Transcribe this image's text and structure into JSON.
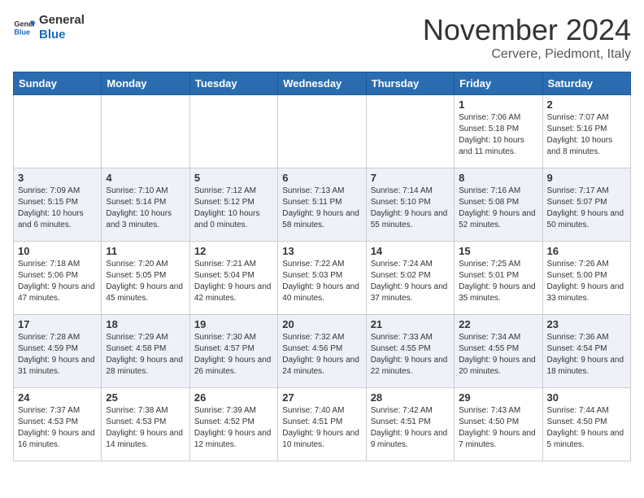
{
  "header": {
    "logo_line1": "General",
    "logo_line2": "Blue",
    "month": "November 2024",
    "location": "Cervere, Piedmont, Italy"
  },
  "weekdays": [
    "Sunday",
    "Monday",
    "Tuesday",
    "Wednesday",
    "Thursday",
    "Friday",
    "Saturday"
  ],
  "weeks": [
    [
      {
        "day": "",
        "info": ""
      },
      {
        "day": "",
        "info": ""
      },
      {
        "day": "",
        "info": ""
      },
      {
        "day": "",
        "info": ""
      },
      {
        "day": "",
        "info": ""
      },
      {
        "day": "1",
        "info": "Sunrise: 7:06 AM\nSunset: 5:18 PM\nDaylight: 10 hours and 11 minutes."
      },
      {
        "day": "2",
        "info": "Sunrise: 7:07 AM\nSunset: 5:16 PM\nDaylight: 10 hours and 8 minutes."
      }
    ],
    [
      {
        "day": "3",
        "info": "Sunrise: 7:09 AM\nSunset: 5:15 PM\nDaylight: 10 hours and 6 minutes."
      },
      {
        "day": "4",
        "info": "Sunrise: 7:10 AM\nSunset: 5:14 PM\nDaylight: 10 hours and 3 minutes."
      },
      {
        "day": "5",
        "info": "Sunrise: 7:12 AM\nSunset: 5:12 PM\nDaylight: 10 hours and 0 minutes."
      },
      {
        "day": "6",
        "info": "Sunrise: 7:13 AM\nSunset: 5:11 PM\nDaylight: 9 hours and 58 minutes."
      },
      {
        "day": "7",
        "info": "Sunrise: 7:14 AM\nSunset: 5:10 PM\nDaylight: 9 hours and 55 minutes."
      },
      {
        "day": "8",
        "info": "Sunrise: 7:16 AM\nSunset: 5:08 PM\nDaylight: 9 hours and 52 minutes."
      },
      {
        "day": "9",
        "info": "Sunrise: 7:17 AM\nSunset: 5:07 PM\nDaylight: 9 hours and 50 minutes."
      }
    ],
    [
      {
        "day": "10",
        "info": "Sunrise: 7:18 AM\nSunset: 5:06 PM\nDaylight: 9 hours and 47 minutes."
      },
      {
        "day": "11",
        "info": "Sunrise: 7:20 AM\nSunset: 5:05 PM\nDaylight: 9 hours and 45 minutes."
      },
      {
        "day": "12",
        "info": "Sunrise: 7:21 AM\nSunset: 5:04 PM\nDaylight: 9 hours and 42 minutes."
      },
      {
        "day": "13",
        "info": "Sunrise: 7:22 AM\nSunset: 5:03 PM\nDaylight: 9 hours and 40 minutes."
      },
      {
        "day": "14",
        "info": "Sunrise: 7:24 AM\nSunset: 5:02 PM\nDaylight: 9 hours and 37 minutes."
      },
      {
        "day": "15",
        "info": "Sunrise: 7:25 AM\nSunset: 5:01 PM\nDaylight: 9 hours and 35 minutes."
      },
      {
        "day": "16",
        "info": "Sunrise: 7:26 AM\nSunset: 5:00 PM\nDaylight: 9 hours and 33 minutes."
      }
    ],
    [
      {
        "day": "17",
        "info": "Sunrise: 7:28 AM\nSunset: 4:59 PM\nDaylight: 9 hours and 31 minutes."
      },
      {
        "day": "18",
        "info": "Sunrise: 7:29 AM\nSunset: 4:58 PM\nDaylight: 9 hours and 28 minutes."
      },
      {
        "day": "19",
        "info": "Sunrise: 7:30 AM\nSunset: 4:57 PM\nDaylight: 9 hours and 26 minutes."
      },
      {
        "day": "20",
        "info": "Sunrise: 7:32 AM\nSunset: 4:56 PM\nDaylight: 9 hours and 24 minutes."
      },
      {
        "day": "21",
        "info": "Sunrise: 7:33 AM\nSunset: 4:55 PM\nDaylight: 9 hours and 22 minutes."
      },
      {
        "day": "22",
        "info": "Sunrise: 7:34 AM\nSunset: 4:55 PM\nDaylight: 9 hours and 20 minutes."
      },
      {
        "day": "23",
        "info": "Sunrise: 7:36 AM\nSunset: 4:54 PM\nDaylight: 9 hours and 18 minutes."
      }
    ],
    [
      {
        "day": "24",
        "info": "Sunrise: 7:37 AM\nSunset: 4:53 PM\nDaylight: 9 hours and 16 minutes."
      },
      {
        "day": "25",
        "info": "Sunrise: 7:38 AM\nSunset: 4:53 PM\nDaylight: 9 hours and 14 minutes."
      },
      {
        "day": "26",
        "info": "Sunrise: 7:39 AM\nSunset: 4:52 PM\nDaylight: 9 hours and 12 minutes."
      },
      {
        "day": "27",
        "info": "Sunrise: 7:40 AM\nSunset: 4:51 PM\nDaylight: 9 hours and 10 minutes."
      },
      {
        "day": "28",
        "info": "Sunrise: 7:42 AM\nSunset: 4:51 PM\nDaylight: 9 hours and 9 minutes."
      },
      {
        "day": "29",
        "info": "Sunrise: 7:43 AM\nSunset: 4:50 PM\nDaylight: 9 hours and 7 minutes."
      },
      {
        "day": "30",
        "info": "Sunrise: 7:44 AM\nSunset: 4:50 PM\nDaylight: 9 hours and 5 minutes."
      }
    ]
  ]
}
